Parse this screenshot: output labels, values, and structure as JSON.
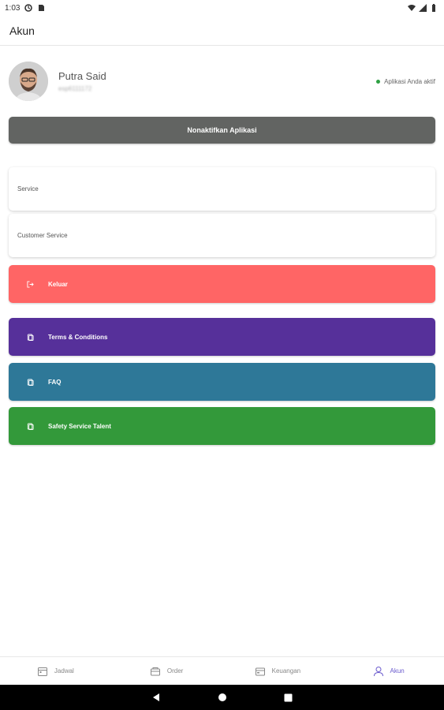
{
  "status_bar": {
    "time": "1:03"
  },
  "app_bar": {
    "title": "Akun"
  },
  "profile": {
    "name": "Putra Said",
    "sub": "esp6111172",
    "status_text": "Aplikasi Anda aktif",
    "status_color": "#2ea043"
  },
  "deactivate_button": {
    "label": "Nonaktifkan Aplikasi",
    "color": "#626462"
  },
  "cards": [
    {
      "label": "Service"
    },
    {
      "label": "Customer Service"
    }
  ],
  "actions": [
    {
      "label": "Keluar",
      "icon": "logout-icon",
      "color": "#ff6565"
    },
    {
      "label": "Terms & Conditions",
      "icon": "document-icon",
      "color": "#56309a"
    },
    {
      "label": "FAQ",
      "icon": "document-icon",
      "color": "#2e7898"
    },
    {
      "label": "Safety Service Talent",
      "icon": "document-icon",
      "color": "#33993a"
    }
  ],
  "bottom_nav": [
    {
      "label": "Jadwal",
      "icon": "calendar-icon",
      "active": false
    },
    {
      "label": "Order",
      "icon": "box-icon",
      "active": false
    },
    {
      "label": "Keuangan",
      "icon": "wallet-icon",
      "active": false
    },
    {
      "label": "Akun",
      "icon": "user-icon",
      "active": true
    }
  ],
  "colors": {
    "active_nav": "#6a5acd"
  }
}
